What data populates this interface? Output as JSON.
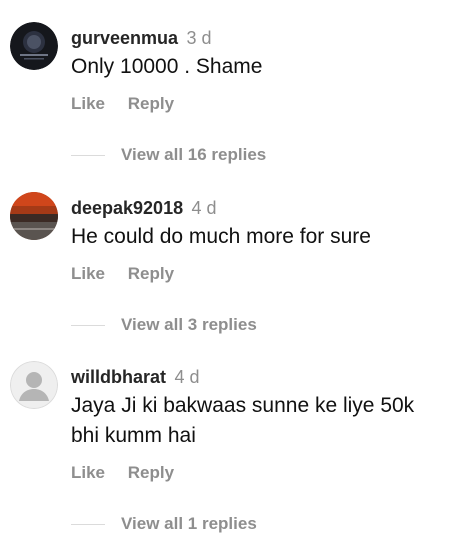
{
  "comments": [
    {
      "username": "gurveenmua",
      "time": "3 d",
      "text": "Only 10000 . Shame",
      "like_label": "Like",
      "reply_label": "Reply",
      "view_replies_label": "View all 16 replies"
    },
    {
      "username": "deepak92018",
      "time": "4 d",
      "text": "He could do much more for sure",
      "like_label": "Like",
      "reply_label": "Reply",
      "view_replies_label": "View all 3 replies"
    },
    {
      "username": "willdbharat",
      "time": "4 d",
      "text": "Jaya Ji ki bakwaas sunne ke liye 50k bhi kumm hai",
      "like_label": "Like",
      "reply_label": "Reply",
      "view_replies_label": "View all 1 replies"
    }
  ],
  "colors": {
    "username": "#262626",
    "secondary_text": "#8e8e8e",
    "divider": "#dbdbdb"
  }
}
